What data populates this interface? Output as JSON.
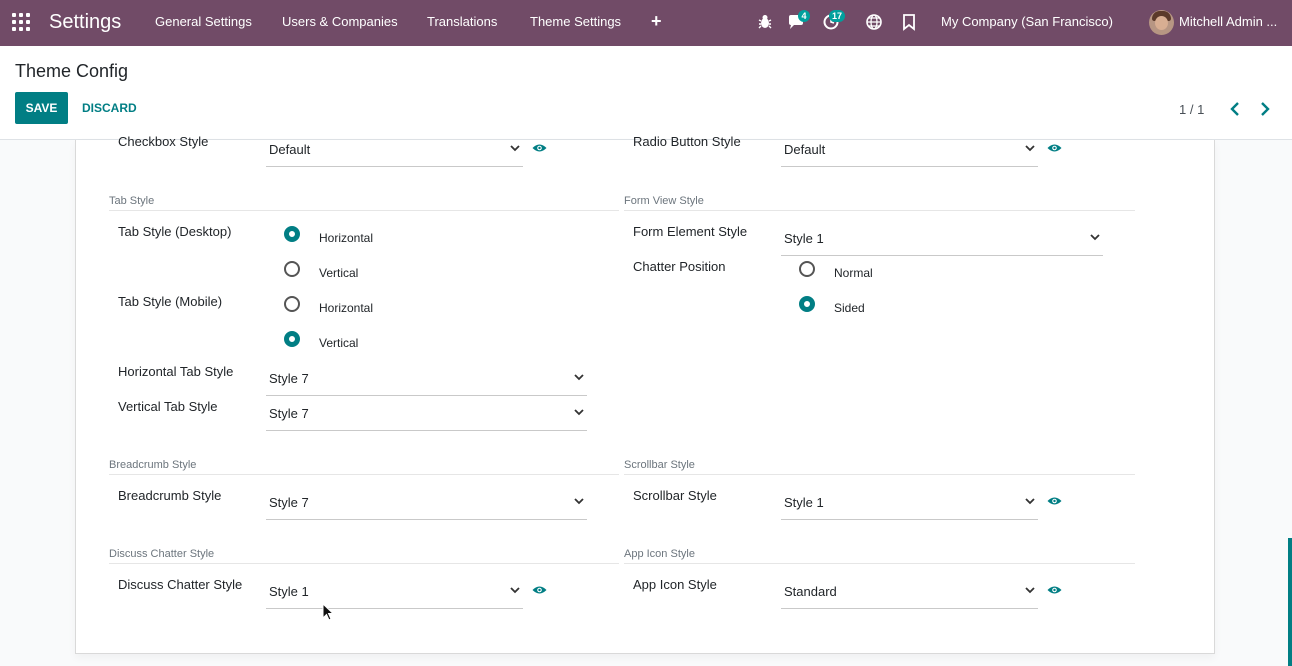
{
  "navbar": {
    "brand": "Settings",
    "menu": [
      "General Settings",
      "Users & Companies",
      "Translations",
      "Theme Settings"
    ],
    "add_icon": "plus-icon",
    "messages_badge": "4",
    "activities_badge": "17",
    "company": "My Company (San Francisco)",
    "user": "Mitchell Admin ..."
  },
  "control_panel": {
    "title": "Theme Config",
    "save": "SAVE",
    "discard": "DISCARD",
    "pager": "1 / 1"
  },
  "form": {
    "checkbox_style": {
      "label": "Checkbox Style",
      "value": "Default"
    },
    "radio_button_style": {
      "label": "Radio Button Style",
      "value": "Default"
    },
    "tab_section": "Tab Style",
    "tab_desktop": {
      "label": "Tab Style (Desktop)",
      "options": [
        "Horizontal",
        "Vertical"
      ],
      "selected": "Horizontal"
    },
    "tab_mobile": {
      "label": "Tab Style (Mobile)",
      "options": [
        "Horizontal",
        "Vertical"
      ],
      "selected": "Vertical"
    },
    "horizontal_tab_style": {
      "label": "Horizontal Tab Style",
      "value": "Style 7"
    },
    "vertical_tab_style": {
      "label": "Vertical Tab Style",
      "value": "Style 7"
    },
    "form_view_section": "Form View Style",
    "form_element_style": {
      "label": "Form Element Style",
      "value": "Style 1"
    },
    "chatter_position": {
      "label": "Chatter Position",
      "options": [
        "Normal",
        "Sided"
      ],
      "selected": "Sided"
    },
    "breadcrumb_section": "Breadcrumb Style",
    "breadcrumb_style": {
      "label": "Breadcrumb Style",
      "value": "Style 7"
    },
    "scrollbar_section": "Scrollbar Style",
    "scrollbar_style": {
      "label": "Scrollbar Style",
      "value": "Style 1"
    },
    "discuss_section": "Discuss Chatter Style",
    "discuss_chatter_style": {
      "label": "Discuss Chatter Style",
      "value": "Style 1"
    },
    "app_icon_section": "App Icon Style",
    "app_icon_style": {
      "label": "App Icon Style",
      "value": "Standard"
    }
  },
  "colors": {
    "navbar": "#714b67",
    "primary": "#017e84",
    "badge": "#00a09d"
  }
}
